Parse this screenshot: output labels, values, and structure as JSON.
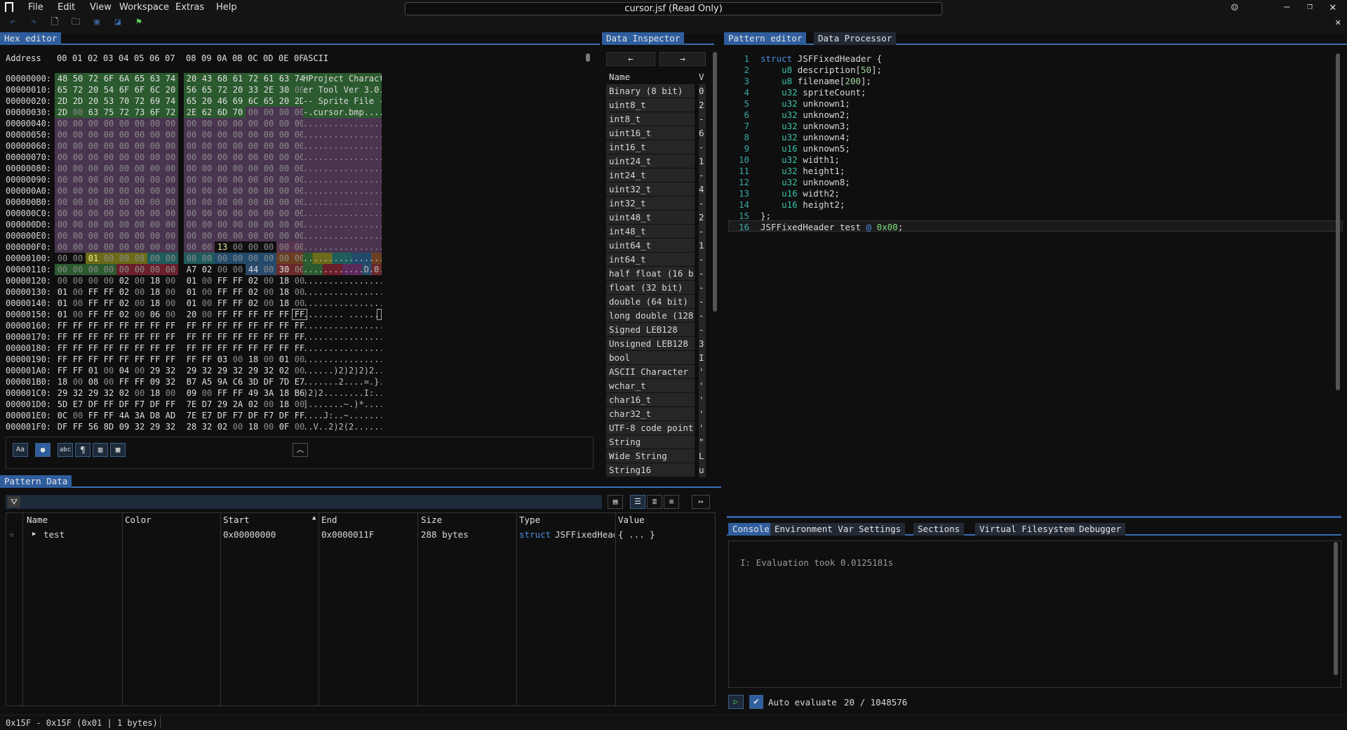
{
  "app": {
    "title": "cursor.jsf (Read Only)"
  },
  "menu": {
    "file": "File",
    "edit": "Edit",
    "view": "View",
    "workspace": "Workspace",
    "extras": "Extras",
    "help": "Help"
  },
  "hex_editor": {
    "tab": "Hex editor",
    "header_address": "Address",
    "header_bytes": [
      "00",
      "01",
      "02",
      "03",
      "04",
      "05",
      "06",
      "07",
      "08",
      "09",
      "0A",
      "0B",
      "0C",
      "0D",
      "0E",
      "0F"
    ],
    "header_ascii": "ASCII",
    "rows": [
      {
        "addr": "00000000:",
        "bytes": [
          "48",
          "50",
          "72",
          "6F",
          "6A",
          "65",
          "63",
          "74",
          "20",
          "43",
          "68",
          "61",
          "72",
          "61",
          "63",
          "74"
        ],
        "ascii": "HProject Charact"
      },
      {
        "addr": "00000010:",
        "bytes": [
          "65",
          "72",
          "20",
          "54",
          "6F",
          "6F",
          "6C",
          "20",
          "56",
          "65",
          "72",
          "20",
          "33",
          "2E",
          "30",
          "00"
        ],
        "ascii": "er Tool Ver 3.0."
      },
      {
        "addr": "00000020:",
        "bytes": [
          "2D",
          "2D",
          "20",
          "53",
          "70",
          "72",
          "69",
          "74",
          "65",
          "20",
          "46",
          "69",
          "6C",
          "65",
          "20",
          "2D"
        ],
        "ascii": "-- Sprite File -"
      },
      {
        "addr": "00000030:",
        "bytes": [
          "2D",
          "00",
          "63",
          "75",
          "72",
          "73",
          "6F",
          "72",
          "2E",
          "62",
          "6D",
          "70",
          "00",
          "00",
          "00",
          "00"
        ],
        "ascii": "-.cursor.bmp...."
      },
      {
        "addr": "00000040:",
        "bytes": [
          "00",
          "00",
          "00",
          "00",
          "00",
          "00",
          "00",
          "00",
          "00",
          "00",
          "00",
          "00",
          "00",
          "00",
          "00",
          "00"
        ],
        "ascii": "................"
      },
      {
        "addr": "00000050:",
        "bytes": [
          "00",
          "00",
          "00",
          "00",
          "00",
          "00",
          "00",
          "00",
          "00",
          "00",
          "00",
          "00",
          "00",
          "00",
          "00",
          "00"
        ],
        "ascii": "................"
      },
      {
        "addr": "00000060:",
        "bytes": [
          "00",
          "00",
          "00",
          "00",
          "00",
          "00",
          "00",
          "00",
          "00",
          "00",
          "00",
          "00",
          "00",
          "00",
          "00",
          "00"
        ],
        "ascii": "................"
      },
      {
        "addr": "00000070:",
        "bytes": [
          "00",
          "00",
          "00",
          "00",
          "00",
          "00",
          "00",
          "00",
          "00",
          "00",
          "00",
          "00",
          "00",
          "00",
          "00",
          "00"
        ],
        "ascii": "................"
      },
      {
        "addr": "00000080:",
        "bytes": [
          "00",
          "00",
          "00",
          "00",
          "00",
          "00",
          "00",
          "00",
          "00",
          "00",
          "00",
          "00",
          "00",
          "00",
          "00",
          "00"
        ],
        "ascii": "................"
      },
      {
        "addr": "00000090:",
        "bytes": [
          "00",
          "00",
          "00",
          "00",
          "00",
          "00",
          "00",
          "00",
          "00",
          "00",
          "00",
          "00",
          "00",
          "00",
          "00",
          "00"
        ],
        "ascii": "................"
      },
      {
        "addr": "000000A0:",
        "bytes": [
          "00",
          "00",
          "00",
          "00",
          "00",
          "00",
          "00",
          "00",
          "00",
          "00",
          "00",
          "00",
          "00",
          "00",
          "00",
          "00"
        ],
        "ascii": "................"
      },
      {
        "addr": "000000B0:",
        "bytes": [
          "00",
          "00",
          "00",
          "00",
          "00",
          "00",
          "00",
          "00",
          "00",
          "00",
          "00",
          "00",
          "00",
          "00",
          "00",
          "00"
        ],
        "ascii": "................"
      },
      {
        "addr": "000000C0:",
        "bytes": [
          "00",
          "00",
          "00",
          "00",
          "00",
          "00",
          "00",
          "00",
          "00",
          "00",
          "00",
          "00",
          "00",
          "00",
          "00",
          "00"
        ],
        "ascii": "................"
      },
      {
        "addr": "000000D0:",
        "bytes": [
          "00",
          "00",
          "00",
          "00",
          "00",
          "00",
          "00",
          "00",
          "00",
          "00",
          "00",
          "00",
          "00",
          "00",
          "00",
          "00"
        ],
        "ascii": "................"
      },
      {
        "addr": "000000E0:",
        "bytes": [
          "00",
          "00",
          "00",
          "00",
          "00",
          "00",
          "00",
          "00",
          "00",
          "00",
          "00",
          "00",
          "00",
          "00",
          "00",
          "00"
        ],
        "ascii": "................"
      },
      {
        "addr": "000000F0:",
        "bytes": [
          "00",
          "00",
          "00",
          "00",
          "00",
          "00",
          "00",
          "00",
          "00",
          "00",
          "13",
          "00",
          "00",
          "00",
          "00",
          "00"
        ],
        "ascii": "................"
      },
      {
        "addr": "00000100:",
        "bytes": [
          "00",
          "00",
          "01",
          "00",
          "00",
          "00",
          "00",
          "00",
          "00",
          "00",
          "00",
          "00",
          "00",
          "00",
          "00",
          "00"
        ],
        "ascii": "................"
      },
      {
        "addr": "00000110:",
        "bytes": [
          "00",
          "00",
          "00",
          "00",
          "00",
          "00",
          "00",
          "00",
          "A7",
          "02",
          "00",
          "00",
          "44",
          "00",
          "30",
          "00"
        ],
        "ascii": "............D.0."
      },
      {
        "addr": "00000120:",
        "bytes": [
          "00",
          "00",
          "00",
          "00",
          "02",
          "00",
          "18",
          "00",
          "01",
          "00",
          "FF",
          "FF",
          "02",
          "00",
          "18",
          "00"
        ],
        "ascii": "................"
      },
      {
        "addr": "00000130:",
        "bytes": [
          "01",
          "00",
          "FF",
          "FF",
          "02",
          "00",
          "18",
          "00",
          "01",
          "00",
          "FF",
          "FF",
          "02",
          "00",
          "18",
          "00"
        ],
        "ascii": "................"
      },
      {
        "addr": "00000140:",
        "bytes": [
          "01",
          "00",
          "FF",
          "FF",
          "02",
          "00",
          "18",
          "00",
          "01",
          "00",
          "FF",
          "FF",
          "02",
          "00",
          "18",
          "00"
        ],
        "ascii": "................"
      },
      {
        "addr": "00000150:",
        "bytes": [
          "01",
          "00",
          "FF",
          "FF",
          "02",
          "00",
          "06",
          "00",
          "20",
          "00",
          "FF",
          "FF",
          "FF",
          "FF",
          "FF",
          "FF"
        ],
        "ascii": "........ ......."
      },
      {
        "addr": "00000160:",
        "bytes": [
          "FF",
          "FF",
          "FF",
          "FF",
          "FF",
          "FF",
          "FF",
          "FF",
          "FF",
          "FF",
          "FF",
          "FF",
          "FF",
          "FF",
          "FF",
          "FF"
        ],
        "ascii": "................"
      },
      {
        "addr": "00000170:",
        "bytes": [
          "FF",
          "FF",
          "FF",
          "FF",
          "FF",
          "FF",
          "FF",
          "FF",
          "FF",
          "FF",
          "FF",
          "FF",
          "FF",
          "FF",
          "FF",
          "FF"
        ],
        "ascii": "................"
      },
      {
        "addr": "00000180:",
        "bytes": [
          "FF",
          "FF",
          "FF",
          "FF",
          "FF",
          "FF",
          "FF",
          "FF",
          "FF",
          "FF",
          "FF",
          "FF",
          "FF",
          "FF",
          "FF",
          "FF"
        ],
        "ascii": "................"
      },
      {
        "addr": "00000190:",
        "bytes": [
          "FF",
          "FF",
          "FF",
          "FF",
          "FF",
          "FF",
          "FF",
          "FF",
          "FF",
          "FF",
          "03",
          "00",
          "18",
          "00",
          "01",
          "00"
        ],
        "ascii": "................"
      },
      {
        "addr": "000001A0:",
        "bytes": [
          "FF",
          "FF",
          "01",
          "00",
          "04",
          "00",
          "29",
          "32",
          "29",
          "32",
          "29",
          "32",
          "29",
          "32",
          "02",
          "00"
        ],
        "ascii": "......)2)2)2)2.."
      },
      {
        "addr": "000001B0:",
        "bytes": [
          "18",
          "00",
          "08",
          "00",
          "FF",
          "FF",
          "09",
          "32",
          "B7",
          "A5",
          "9A",
          "C6",
          "3D",
          "DF",
          "7D",
          "E7"
        ],
        "ascii": ".......2....=.}."
      },
      {
        "addr": "000001C0:",
        "bytes": [
          "29",
          "32",
          "29",
          "32",
          "02",
          "00",
          "18",
          "00",
          "09",
          "00",
          "FF",
          "FF",
          "49",
          "3A",
          "18",
          "B6"
        ],
        "ascii": ")2)2........I:.."
      },
      {
        "addr": "000001D0:",
        "bytes": [
          "5D",
          "E7",
          "DF",
          "FF",
          "DF",
          "F7",
          "DF",
          "FF",
          "7E",
          "D7",
          "29",
          "2A",
          "02",
          "00",
          "18",
          "00"
        ],
        "ascii": "].......~.)*...."
      },
      {
        "addr": "000001E0:",
        "bytes": [
          "0C",
          "00",
          "FF",
          "FF",
          "4A",
          "3A",
          "D8",
          "AD",
          "7E",
          "E7",
          "DF",
          "F7",
          "DF",
          "F7",
          "DF",
          "FF"
        ],
        "ascii": "....J:..~......."
      },
      {
        "addr": "000001F0:",
        "bytes": [
          "DF",
          "FF",
          "56",
          "8D",
          "09",
          "32",
          "29",
          "32",
          "28",
          "32",
          "02",
          "00",
          "18",
          "00",
          "0F",
          "00"
        ],
        "ascii": "..V..2)2(2......"
      }
    ]
  },
  "data_inspector": {
    "tab": "Data Inspector",
    "back": "←",
    "forward": "→",
    "col_name": "Name",
    "col_value": "V",
    "rows": [
      {
        "name": "Binary (8 bit)",
        "value": "0"
      },
      {
        "name": "uint8_t",
        "value": "2"
      },
      {
        "name": "int8_t",
        "value": "-"
      },
      {
        "name": "uint16_t",
        "value": "6"
      },
      {
        "name": "int16_t",
        "value": "-"
      },
      {
        "name": "uint24_t",
        "value": "1"
      },
      {
        "name": "int24_t",
        "value": "-"
      },
      {
        "name": "uint32_t",
        "value": "4"
      },
      {
        "name": "int32_t",
        "value": "-"
      },
      {
        "name": "uint48_t",
        "value": "2"
      },
      {
        "name": "int48_t",
        "value": "-"
      },
      {
        "name": "uint64_t",
        "value": "1"
      },
      {
        "name": "int64_t",
        "value": "-"
      },
      {
        "name": "half float (16 bit",
        "value": "-"
      },
      {
        "name": "float (32 bit)",
        "value": "-"
      },
      {
        "name": "double (64 bit)",
        "value": "-"
      },
      {
        "name": "long double (128 b",
        "value": "-"
      },
      {
        "name": "Signed LEB128",
        "value": "-"
      },
      {
        "name": "Unsigned LEB128",
        "value": "3"
      },
      {
        "name": "bool",
        "value": "I"
      },
      {
        "name": "ASCII Character",
        "value": "'"
      },
      {
        "name": "wchar_t",
        "value": "'"
      },
      {
        "name": "char16_t",
        "value": "'"
      },
      {
        "name": "char32_t",
        "value": "'"
      },
      {
        "name": "UTF-8 code point",
        "value": "'"
      },
      {
        "name": "String",
        "value": "\""
      },
      {
        "name": "Wide String",
        "value": "L"
      },
      {
        "name": "String16",
        "value": "u"
      }
    ]
  },
  "pattern_editor": {
    "tab": "Pattern editor",
    "tab2": "Data Processor",
    "lines": [
      {
        "n": "1",
        "t": "struct JSFFixedHeader {"
      },
      {
        "n": "2",
        "t": "    u8 description[50];"
      },
      {
        "n": "3",
        "t": "    u8 filename[200];"
      },
      {
        "n": "4",
        "t": "    u32 spriteCount;"
      },
      {
        "n": "5",
        "t": "    u32 unknown1;"
      },
      {
        "n": "6",
        "t": "    u32 unknown2;"
      },
      {
        "n": "7",
        "t": "    u32 unknown3;"
      },
      {
        "n": "8",
        "t": "    u32 unknown4;"
      },
      {
        "n": "9",
        "t": "    u16 unknown5;"
      },
      {
        "n": "10",
        "t": "    u32 width1;"
      },
      {
        "n": "11",
        "t": "    u32 height1;"
      },
      {
        "n": "12",
        "t": "    u32 unknown8;"
      },
      {
        "n": "13",
        "t": "    u16 width2;"
      },
      {
        "n": "14",
        "t": "    u16 height2;"
      },
      {
        "n": "15",
        "t": "};"
      },
      {
        "n": "16",
        "t": "JSFFixedHeader test @ 0x00;"
      }
    ]
  },
  "console_tabs": [
    "Console",
    "Environment Variables",
    "Settings",
    "Sections",
    "Virtual Filesystem",
    "Debugger"
  ],
  "console": {
    "line": "I: Evaluation took 0.0125181s",
    "auto_evaluate": "Auto evaluate",
    "counter": "20 / 1048576"
  },
  "pattern_data": {
    "tab": "Pattern Data",
    "columns": [
      "Name",
      "Color",
      "Start",
      "End",
      "Size",
      "Type",
      "Value"
    ],
    "rows": [
      {
        "name": "test",
        "color": "",
        "start": "0x00000000",
        "end": "0x0000011F",
        "size": "288 bytes",
        "type_kw": "struct",
        "type_name": "JSFFixedHeade",
        "value": "{ ... }"
      }
    ]
  },
  "status": {
    "selection": "0x15F - 0x15F (0x01 | 1 bytes)"
  },
  "colors": {
    "accent": "#2f5e9e",
    "green_bg": "#2b5a2e",
    "purple_bg": "#4a3550",
    "keyword": "#4a8fe0",
    "type": "#3ac0a8",
    "number": "#7ee07e"
  }
}
